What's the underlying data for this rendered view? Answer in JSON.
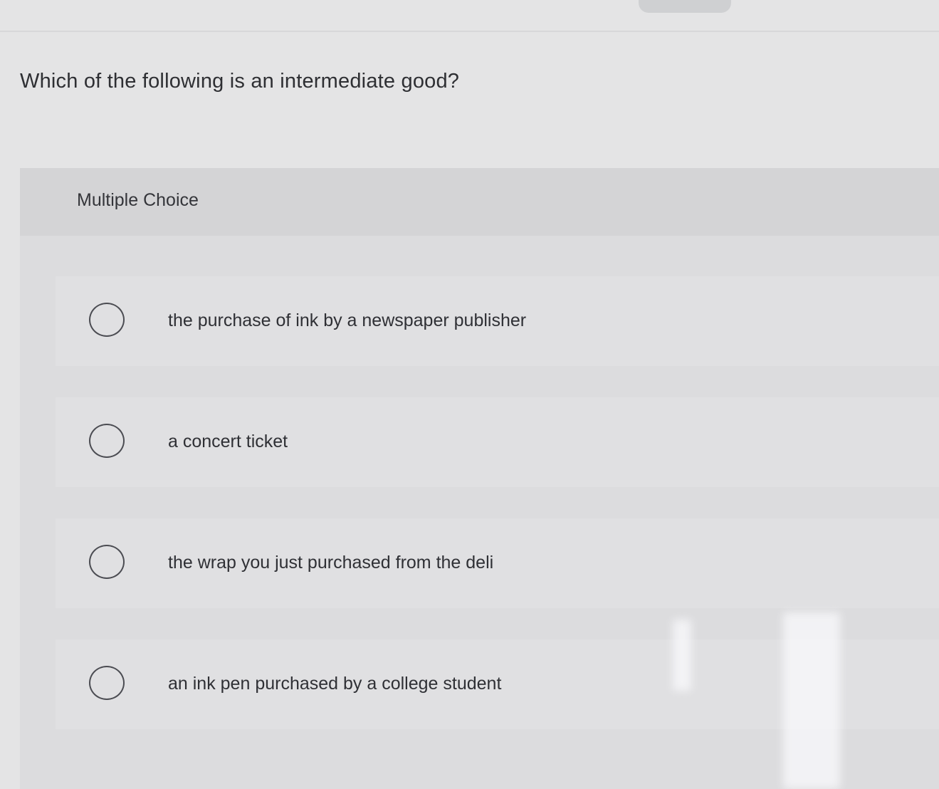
{
  "question": {
    "text": "Which of the following is an intermediate good?"
  },
  "multiple_choice": {
    "label": "Multiple Choice",
    "options": [
      {
        "text": "the purchase of ink by a newspaper publisher",
        "selected": false
      },
      {
        "text": "a concert ticket",
        "selected": false
      },
      {
        "text": "the wrap you just purchased from the deli",
        "selected": false
      },
      {
        "text": "an ink pen purchased by a college student",
        "selected": false
      }
    ]
  },
  "colors": {
    "page_background": "#e4e4e5",
    "panel_background": "#dcdcde",
    "header_background": "#d4d4d6",
    "option_background": "#e0e0e2",
    "text": "#2f3035",
    "radio_border": "#4b4c52"
  }
}
